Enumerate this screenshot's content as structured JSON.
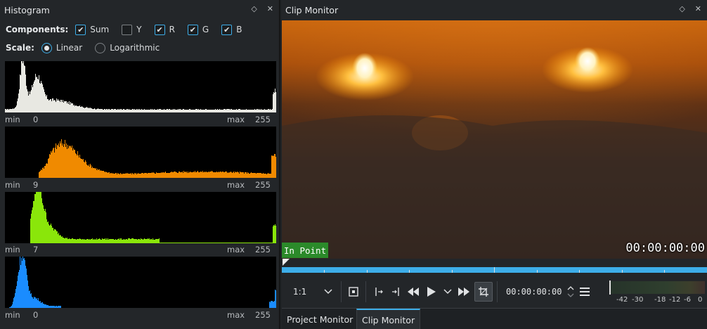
{
  "histogram": {
    "title": "Histogram",
    "components_label": "Components:",
    "components": [
      {
        "label": "Sum",
        "checked": true
      },
      {
        "label": "Y",
        "checked": false
      },
      {
        "label": "R",
        "checked": true
      },
      {
        "label": "G",
        "checked": true
      },
      {
        "label": "B",
        "checked": true
      }
    ],
    "scale_label": "Scale:",
    "scales": [
      {
        "label": "Linear",
        "selected": true
      },
      {
        "label": "Logarithmic",
        "selected": false
      }
    ],
    "channels": [
      {
        "name": "sum",
        "color": "#e8e8e2",
        "min_label": "min",
        "min_value": "0",
        "max_label": "max",
        "max_value": "255"
      },
      {
        "name": "red",
        "color": "#f08a00",
        "min_label": "min",
        "min_value": "9",
        "max_label": "max",
        "max_value": "255"
      },
      {
        "name": "green",
        "color": "#8ae60a",
        "min_label": "min",
        "min_value": "7",
        "max_label": "max",
        "max_value": "255"
      },
      {
        "name": "blue",
        "color": "#1a8cff",
        "min_label": "min",
        "min_value": "0",
        "max_label": "max",
        "max_value": "255"
      }
    ]
  },
  "clip_monitor": {
    "title": "Clip Monitor",
    "in_point_label": "In Point",
    "overlay_timecode": "00:00:00:00",
    "zoom_value": "1:1",
    "position_timecode": "00:00:00:00",
    "vu_labels": [
      "-42",
      "-30",
      "-18",
      "-12",
      "-6",
      "0"
    ]
  },
  "tabs": [
    {
      "label": "Project Monitor",
      "active": false
    },
    {
      "label": "Clip Monitor",
      "active": true
    }
  ],
  "colors": {
    "accent": "#3daee9",
    "in_point": "#2b8a2a"
  }
}
